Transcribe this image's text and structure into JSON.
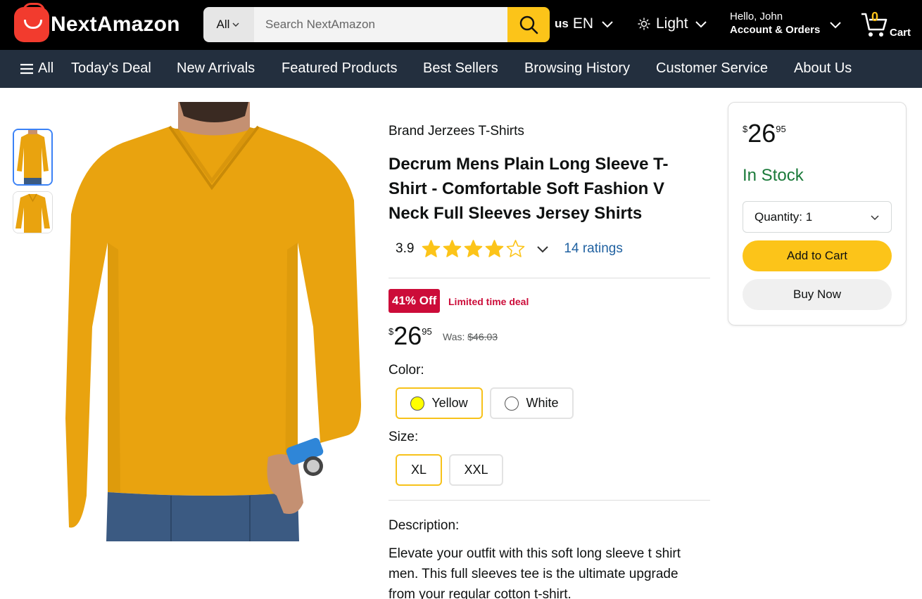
{
  "header": {
    "logo_text": "NextAmazon",
    "search": {
      "category": "All",
      "placeholder": "Search NextAmazon"
    },
    "language": {
      "region": "us",
      "code": "EN"
    },
    "theme_label": "Light",
    "account": {
      "greeting": "Hello, John",
      "label": "Account & Orders"
    },
    "cart": {
      "count": "0",
      "label": "Cart"
    }
  },
  "nav": {
    "all_label": "All",
    "items": [
      "Today's Deal",
      "New Arrivals",
      "Featured Products",
      "Best Sellers",
      "Browsing History",
      "Customer Service",
      "About Us"
    ]
  },
  "product": {
    "brand": "Brand Jerzees T-Shirts",
    "title": "Decrum Mens Plain Long Sleeve T-Shirt - Comfortable Soft Fashion V Neck Full Sleeves Jersey Shirts",
    "rating": {
      "value": "3.9",
      "stars": 3.9,
      "ratings_text": "14 ratings"
    },
    "discount_badge": "41% Off",
    "deal_label": "Limited time deal",
    "price": {
      "currency": "$",
      "whole": "26",
      "fraction": "95"
    },
    "was_label": "Was:",
    "was_price": "$46.03",
    "color_label": "Color:",
    "colors": [
      {
        "name": "Yellow",
        "swatch": "#ffff00",
        "selected": true
      },
      {
        "name": "White",
        "swatch": "#ffffff",
        "selected": false
      }
    ],
    "size_label": "Size:",
    "sizes": [
      {
        "name": "XL",
        "selected": true
      },
      {
        "name": "XXL",
        "selected": false
      }
    ],
    "description_label": "Description:",
    "description": "Elevate your outfit with this soft long sleeve t shirt men. This full sleeves tee is the ultimate upgrade from your regular cotton t-shirt."
  },
  "buybox": {
    "price": {
      "currency": "$",
      "whole": "26",
      "fraction": "95"
    },
    "stock": "In Stock",
    "quantity_label": "Quantity: 1",
    "add_to_cart": "Add to Cart",
    "buy_now": "Buy Now"
  },
  "colors": {
    "accent": "#fcc419",
    "nav_bg": "#232f3e",
    "header_bg": "#000000",
    "deal_red": "#cc0c39",
    "stock_green": "#1b7a3a",
    "link_blue": "#2162a1",
    "shirt": "#e9a30f"
  }
}
